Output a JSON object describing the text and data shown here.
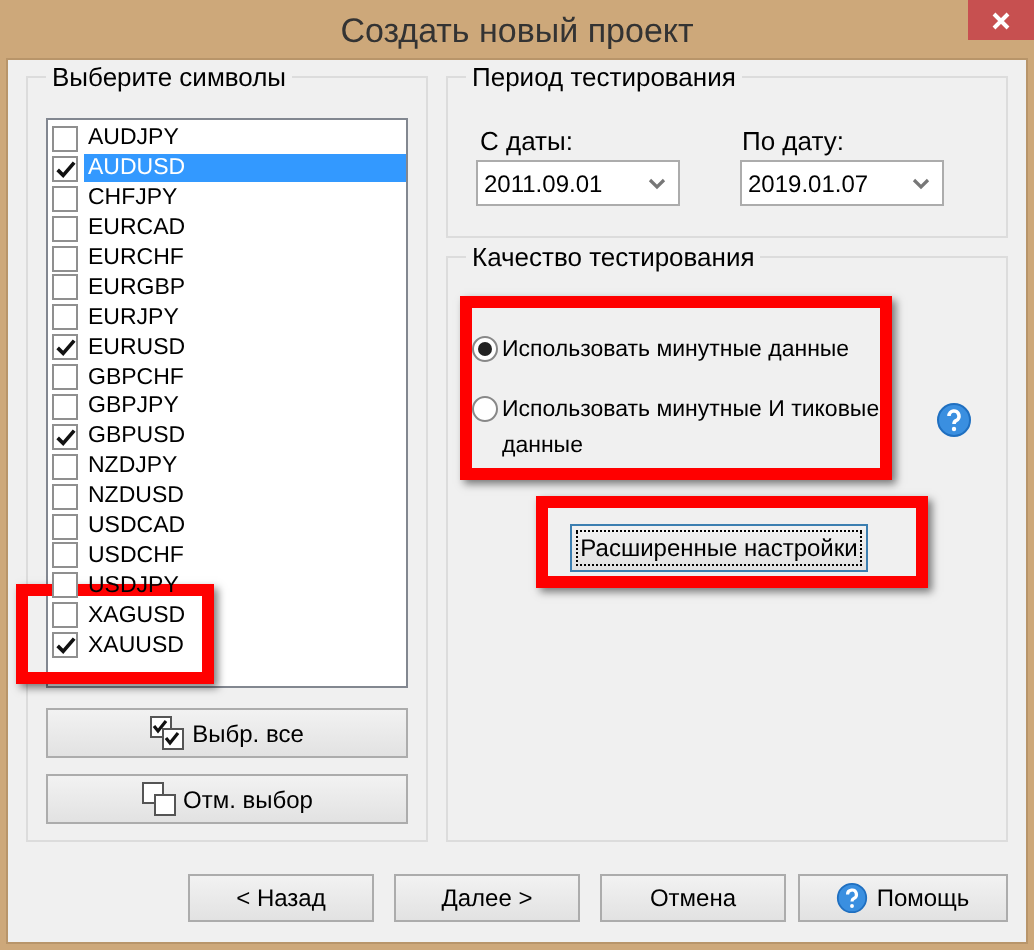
{
  "window": {
    "title": "Создать новый проект"
  },
  "symbols": {
    "title": "Выберите символы",
    "items": [
      {
        "label": "AUDJPY",
        "checked": false,
        "selected": false
      },
      {
        "label": "AUDUSD",
        "checked": true,
        "selected": true
      },
      {
        "label": "CHFJPY",
        "checked": false,
        "selected": false
      },
      {
        "label": "EURCAD",
        "checked": false,
        "selected": false
      },
      {
        "label": "EURCHF",
        "checked": false,
        "selected": false
      },
      {
        "label": "EURGBP",
        "checked": false,
        "selected": false
      },
      {
        "label": "EURJPY",
        "checked": false,
        "selected": false
      },
      {
        "label": "EURUSD",
        "checked": true,
        "selected": false
      },
      {
        "label": "GBPCHF",
        "checked": false,
        "selected": false
      },
      {
        "label": "GBPJPY",
        "checked": false,
        "selected": false
      },
      {
        "label": "GBPUSD",
        "checked": true,
        "selected": false
      },
      {
        "label": "NZDJPY",
        "checked": false,
        "selected": false
      },
      {
        "label": "NZDUSD",
        "checked": false,
        "selected": false
      },
      {
        "label": "USDCAD",
        "checked": false,
        "selected": false
      },
      {
        "label": "USDCHF",
        "checked": false,
        "selected": false
      },
      {
        "label": "USDJPY",
        "checked": false,
        "selected": false
      },
      {
        "label": "XAGUSD",
        "checked": false,
        "selected": false
      },
      {
        "label": "XAUUSD",
        "checked": true,
        "selected": false
      }
    ],
    "select_all": "Выбр. все",
    "deselect": "Отм. выбор"
  },
  "period": {
    "title": "Период тестирования",
    "from_label": "С даты:",
    "from_value": "2011.09.01",
    "to_label": "По дату:",
    "to_value": "2019.01.07"
  },
  "quality": {
    "title": "Качество тестирования",
    "options": [
      {
        "label": "Использовать минутные данные",
        "selected": true
      },
      {
        "label": "Использовать минутные И тиковые данные",
        "selected": false
      }
    ],
    "advanced": "Расширенные настройки"
  },
  "buttons": [
    "< Назад",
    "Далее >",
    "Отмена",
    "Помощь"
  ]
}
